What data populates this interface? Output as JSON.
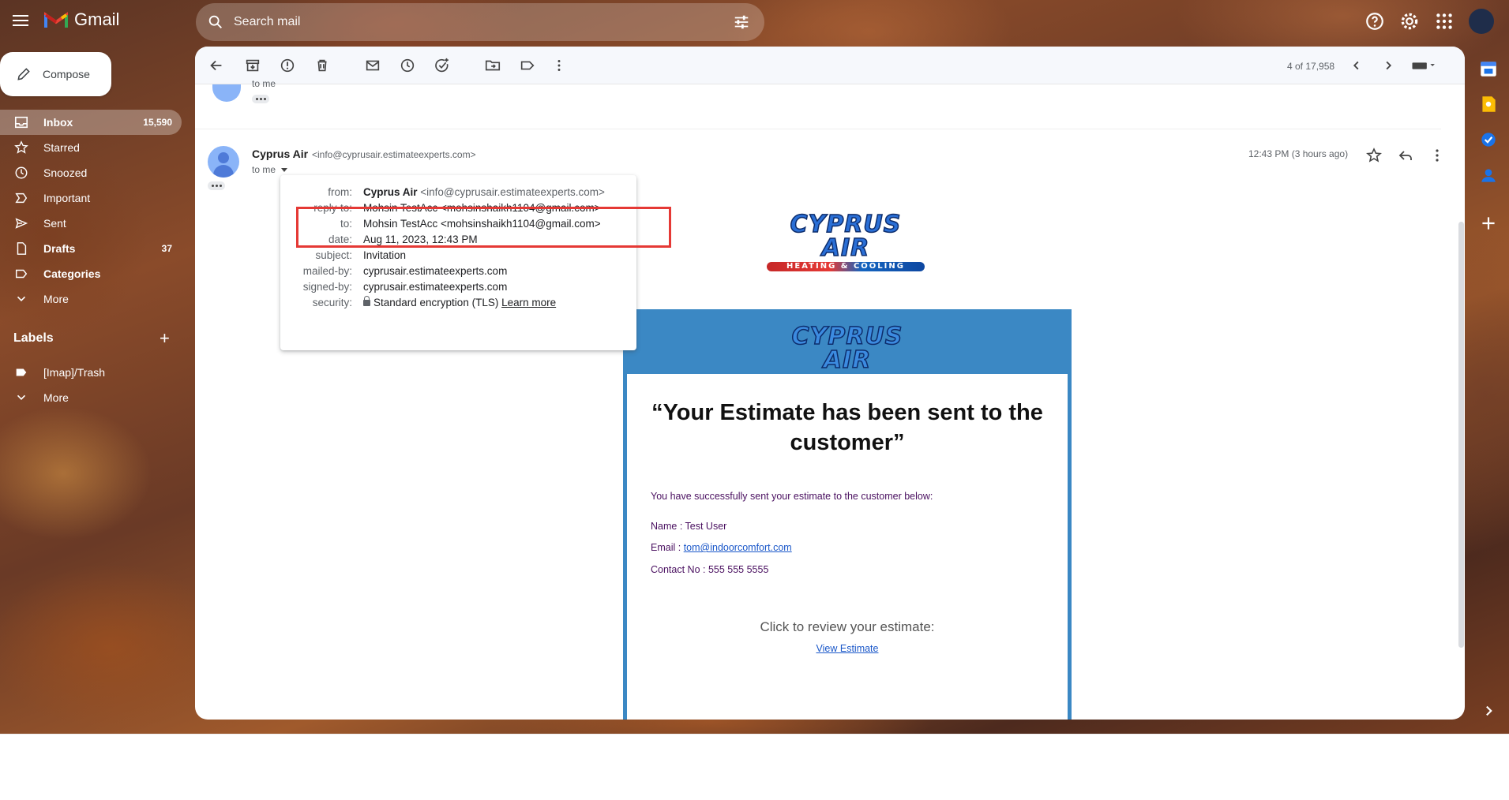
{
  "app": {
    "name": "Gmail"
  },
  "search": {
    "placeholder": "Search mail"
  },
  "compose": {
    "label": "Compose"
  },
  "nav": {
    "items": [
      {
        "label": "Inbox",
        "count": "15,590"
      },
      {
        "label": "Starred",
        "count": ""
      },
      {
        "label": "Snoozed",
        "count": ""
      },
      {
        "label": "Important",
        "count": ""
      },
      {
        "label": "Sent",
        "count": ""
      },
      {
        "label": "Drafts",
        "count": "37"
      },
      {
        "label": "Categories",
        "count": ""
      },
      {
        "label": "More",
        "count": ""
      }
    ],
    "labels_heading": "Labels",
    "labels": [
      {
        "label": "[Imap]/Trash"
      },
      {
        "label": "More"
      }
    ]
  },
  "toolbar": {
    "pager": "4 of 17,958"
  },
  "previous_message": {
    "to_line": "to me"
  },
  "message": {
    "sender_name": "Cyprus Air",
    "sender_email": "<info@cyprusair.estimateexperts.com>",
    "to_line": "to me",
    "time": "12:43 PM (3 hours ago)"
  },
  "details": {
    "rows": [
      {
        "label": "from:",
        "name": "Cyprus Air",
        "value": "<info@cyprusair.estimateexperts.com>"
      },
      {
        "label": "reply-to:",
        "value": "Mohsin TestAcc <mohsinshaikh1104@gmail.com>"
      },
      {
        "label": "to:",
        "value": "Mohsin TestAcc <mohsinshaikh1104@gmail.com>"
      },
      {
        "label": "date:",
        "value": "Aug 11, 2023, 12:43 PM"
      },
      {
        "label": "subject:",
        "value": "Invitation"
      },
      {
        "label": "mailed-by:",
        "value": "cyprusair.estimateexperts.com"
      },
      {
        "label": "signed-by:",
        "value": "cyprusair.estimateexperts.com"
      },
      {
        "label": "security:",
        "value": "Standard encryption (TLS)",
        "link": "Learn more"
      }
    ]
  },
  "brand": {
    "word": "CYPRUS AIR",
    "amp": "HEATING & COOLING"
  },
  "email_body": {
    "title": "“Your Estimate has been sent to the customer”",
    "intro": "You have successfully sent your estimate to the customer below:",
    "name_line": "Name : Test User",
    "email_label": "Email : ",
    "email_link": "tom@indoorcomfort.com",
    "contact_line": "Contact No : 555 555 5555",
    "review_prompt": "Click to review your estimate:",
    "view_link": "View Estimate"
  },
  "colors": {
    "card_blue": "#3b88c4",
    "highlight_red": "#e53935",
    "link_blue": "#1a57c9",
    "body_text_purple": "#4a1060"
  }
}
